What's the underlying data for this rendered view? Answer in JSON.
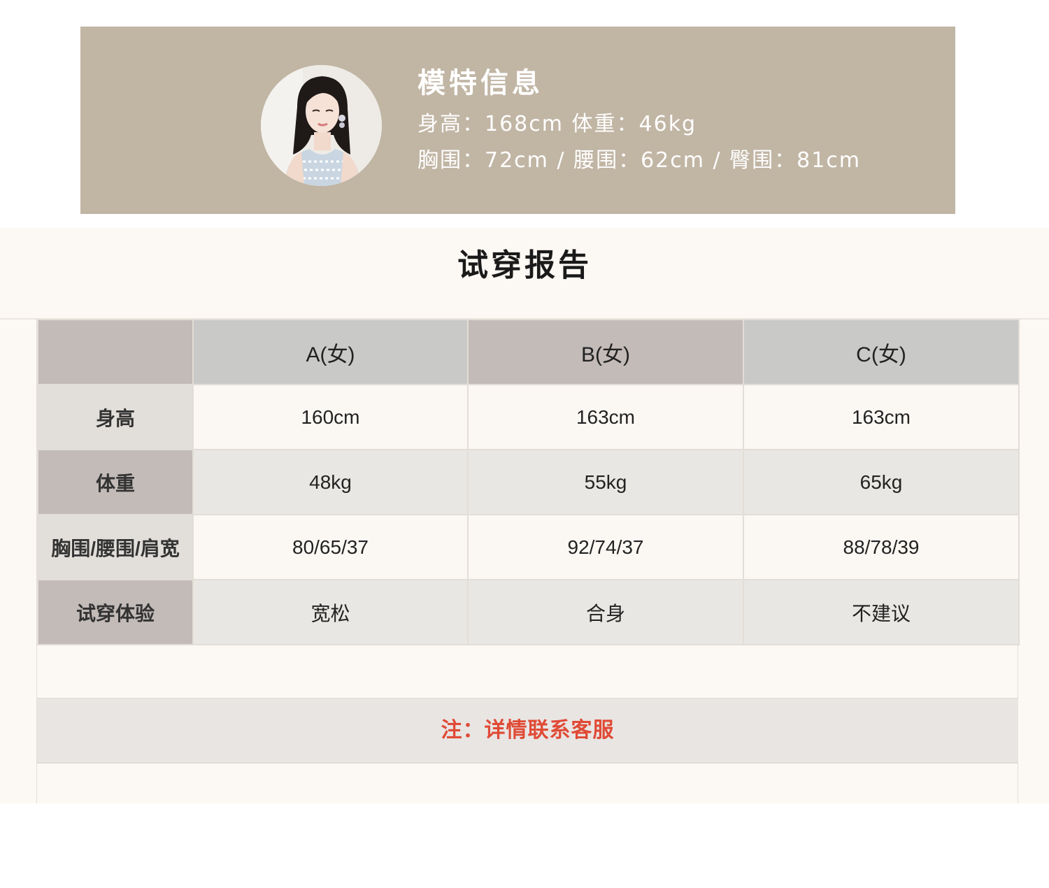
{
  "model": {
    "title": "模特信息",
    "line1": "身高：168cm  体重：46kg",
    "line2": "胸围：72cm / 腰围：62cm / 臀围：81cm"
  },
  "report": {
    "title": "试穿报告",
    "columns": [
      "",
      "A(女)",
      "B(女)",
      "C(女)"
    ],
    "rows": [
      {
        "label": "身高",
        "values": [
          "160cm",
          "163cm",
          "163cm"
        ]
      },
      {
        "label": "体重",
        "values": [
          "48kg",
          "55kg",
          "65kg"
        ]
      },
      {
        "label": "胸围/腰围/肩宽",
        "values": [
          "80/65/37",
          "92/74/37",
          "88/78/39"
        ]
      },
      {
        "label": "试穿体验",
        "values": [
          "宽松",
          "合身",
          "不建议"
        ]
      }
    ],
    "note": "注：详情联系客服"
  },
  "colors": {
    "banner_bg": "#c1b5a4",
    "section_bg": "#fcf8f3",
    "note_text": "#e04a35",
    "header_taupe": "#c3bbb8",
    "header_grey": "#c9c9c7"
  },
  "icons": {
    "avatar": "model-avatar-photo"
  }
}
